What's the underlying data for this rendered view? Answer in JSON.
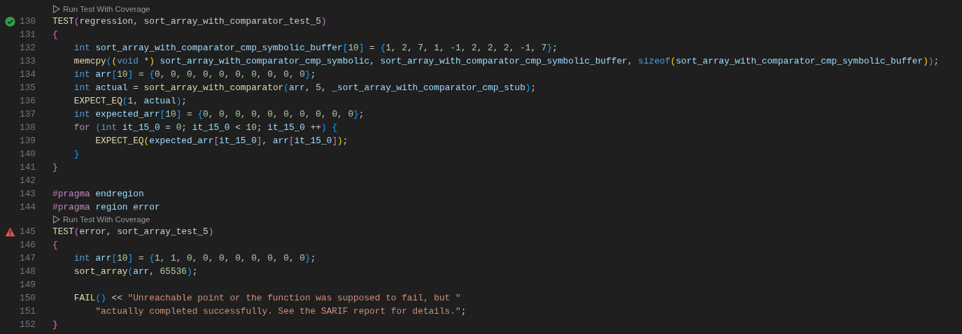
{
  "editor": {
    "lines": [
      {
        "kind": "codelens",
        "label": "Run Test With Coverage"
      },
      {
        "kind": "code",
        "number": "130",
        "passed": true,
        "tokens": [
          {
            "kind": "function",
            "text": "TEST"
          },
          {
            "kind": "bracket2",
            "text": "("
          },
          {
            "kind": "plain",
            "text": "regression, sort_array_with_comparator_test_5"
          },
          {
            "kind": "bracket2",
            "text": ")"
          }
        ]
      },
      {
        "kind": "code",
        "number": "131",
        "tokens": [
          {
            "kind": "bracket2",
            "text": "{"
          }
        ]
      },
      {
        "kind": "code",
        "number": "132",
        "tokens": [
          {
            "kind": "keyword",
            "text": "    int"
          },
          {
            "kind": "variable",
            "text": " sort_array_with_comparator_cmp_symbolic_buffer"
          },
          {
            "kind": "bracket3",
            "text": "["
          },
          {
            "kind": "number",
            "text": "10"
          },
          {
            "kind": "bracket3",
            "text": "]"
          },
          {
            "kind": "plain",
            "text": " = "
          },
          {
            "kind": "bracket3",
            "text": "{"
          },
          {
            "kind": "number",
            "text": "1, 2, 7, 1, -1, 2, 2, 2, -1, 7"
          },
          {
            "kind": "bracket3",
            "text": "}"
          },
          {
            "kind": "plain",
            "text": ";"
          }
        ]
      },
      {
        "kind": "code",
        "number": "133",
        "tokens": [
          {
            "kind": "function",
            "text": "    memcpy"
          },
          {
            "kind": "bracket3",
            "text": "("
          },
          {
            "kind": "bracket1",
            "text": "("
          },
          {
            "kind": "keyword",
            "text": "void"
          },
          {
            "kind": "plain",
            "text": " *"
          },
          {
            "kind": "bracket1",
            "text": ")"
          },
          {
            "kind": "variable",
            "text": " sort_array_with_comparator_cmp_symbolic"
          },
          {
            "kind": "plain",
            "text": ", "
          },
          {
            "kind": "variable",
            "text": "sort_array_with_comparator_cmp_symbolic_buffer"
          },
          {
            "kind": "plain",
            "text": ", "
          },
          {
            "kind": "keyword",
            "text": "sizeof"
          },
          {
            "kind": "bracket1",
            "text": "("
          },
          {
            "kind": "variable",
            "text": "sort_array_with_comparator_cmp_symbolic_buffer"
          },
          {
            "kind": "bracket1",
            "text": ")"
          },
          {
            "kind": "bracket3",
            "text": ")"
          },
          {
            "kind": "plain",
            "text": ";"
          }
        ]
      },
      {
        "kind": "code",
        "number": "134",
        "tokens": [
          {
            "kind": "keyword",
            "text": "    int"
          },
          {
            "kind": "variable",
            "text": " arr"
          },
          {
            "kind": "bracket3",
            "text": "["
          },
          {
            "kind": "number",
            "text": "10"
          },
          {
            "kind": "bracket3",
            "text": "]"
          },
          {
            "kind": "plain",
            "text": " = "
          },
          {
            "kind": "bracket3",
            "text": "{"
          },
          {
            "kind": "number",
            "text": "0, 0, 0, 0, 0, 0, 0, 0, 0, 0"
          },
          {
            "kind": "bracket3",
            "text": "}"
          },
          {
            "kind": "plain",
            "text": ";"
          }
        ]
      },
      {
        "kind": "code",
        "number": "135",
        "tokens": [
          {
            "kind": "keyword",
            "text": "    int"
          },
          {
            "kind": "variable",
            "text": " actual"
          },
          {
            "kind": "plain",
            "text": " = "
          },
          {
            "kind": "function",
            "text": "sort_array_with_comparator"
          },
          {
            "kind": "bracket3",
            "text": "("
          },
          {
            "kind": "variable",
            "text": "arr"
          },
          {
            "kind": "plain",
            "text": ", "
          },
          {
            "kind": "number",
            "text": "5"
          },
          {
            "kind": "plain",
            "text": ", "
          },
          {
            "kind": "variable",
            "text": "_sort_array_with_comparator_cmp_stub"
          },
          {
            "kind": "bracket3",
            "text": ")"
          },
          {
            "kind": "plain",
            "text": ";"
          }
        ]
      },
      {
        "kind": "code",
        "number": "136",
        "tokens": [
          {
            "kind": "function",
            "text": "    EXPECT_EQ"
          },
          {
            "kind": "bracket3",
            "text": "("
          },
          {
            "kind": "number",
            "text": "1"
          },
          {
            "kind": "plain",
            "text": ", "
          },
          {
            "kind": "variable",
            "text": "actual"
          },
          {
            "kind": "bracket3",
            "text": ")"
          },
          {
            "kind": "plain",
            "text": ";"
          }
        ]
      },
      {
        "kind": "code",
        "number": "137",
        "tokens": [
          {
            "kind": "keyword",
            "text": "    int"
          },
          {
            "kind": "variable",
            "text": " expected_arr"
          },
          {
            "kind": "bracket3",
            "text": "["
          },
          {
            "kind": "number",
            "text": "10"
          },
          {
            "kind": "bracket3",
            "text": "]"
          },
          {
            "kind": "plain",
            "text": " = "
          },
          {
            "kind": "bracket3",
            "text": "{"
          },
          {
            "kind": "number",
            "text": "0, 0, 0, 0, 0, 0, 0, 0, 0, 0"
          },
          {
            "kind": "bracket3",
            "text": "}"
          },
          {
            "kind": "plain",
            "text": ";"
          }
        ]
      },
      {
        "kind": "code",
        "number": "138",
        "tokens": [
          {
            "kind": "control",
            "text": "    for"
          },
          {
            "kind": "bracket3",
            "text": " ("
          },
          {
            "kind": "keyword",
            "text": "int"
          },
          {
            "kind": "variable",
            "text": " it_15_0"
          },
          {
            "kind": "plain",
            "text": " = "
          },
          {
            "kind": "number",
            "text": "0"
          },
          {
            "kind": "plain",
            "text": "; "
          },
          {
            "kind": "variable",
            "text": "it_15_0"
          },
          {
            "kind": "plain",
            "text": " < "
          },
          {
            "kind": "number",
            "text": "10"
          },
          {
            "kind": "plain",
            "text": "; "
          },
          {
            "kind": "variable",
            "text": "it_15_0"
          },
          {
            "kind": "plain",
            "text": " ++"
          },
          {
            "kind": "bracket3",
            "text": ")"
          },
          {
            "kind": "bracket3",
            "text": " {"
          }
        ]
      },
      {
        "kind": "code",
        "number": "139",
        "tokens": [
          {
            "kind": "function",
            "text": "        EXPECT_EQ"
          },
          {
            "kind": "bracket1",
            "text": "("
          },
          {
            "kind": "variable",
            "text": "expected_arr"
          },
          {
            "kind": "bracket2",
            "text": "["
          },
          {
            "kind": "variable",
            "text": "it_15_0"
          },
          {
            "kind": "bracket2",
            "text": "]"
          },
          {
            "kind": "plain",
            "text": ", "
          },
          {
            "kind": "variable",
            "text": "arr"
          },
          {
            "kind": "bracket2",
            "text": "["
          },
          {
            "kind": "variable",
            "text": "it_15_0"
          },
          {
            "kind": "bracket2",
            "text": "]"
          },
          {
            "kind": "bracket1",
            "text": ")"
          },
          {
            "kind": "plain",
            "text": ";"
          }
        ]
      },
      {
        "kind": "code",
        "number": "140",
        "tokens": [
          {
            "kind": "bracket3",
            "text": "    }"
          }
        ]
      },
      {
        "kind": "code",
        "number": "141",
        "tokens": [
          {
            "kind": "bracket2",
            "text": "}"
          }
        ]
      },
      {
        "kind": "code",
        "number": "142"
      },
      {
        "kind": "code",
        "number": "143",
        "tokens": [
          {
            "kind": "directive",
            "text": "#pragma"
          },
          {
            "kind": "variable",
            "text": " endregion"
          }
        ]
      },
      {
        "kind": "code",
        "number": "144",
        "tokens": [
          {
            "kind": "directive",
            "text": "#pragma"
          },
          {
            "kind": "variable",
            "text": " region error"
          }
        ]
      },
      {
        "kind": "codelens",
        "label": "Run Test With Coverage"
      },
      {
        "kind": "code",
        "number": "145",
        "passed": false,
        "tokens": [
          {
            "kind": "function",
            "text": "TEST"
          },
          {
            "kind": "bracket2",
            "text": "("
          },
          {
            "kind": "plain",
            "text": "error, sort_array_test_5"
          },
          {
            "kind": "bracket2",
            "text": ")"
          }
        ]
      },
      {
        "kind": "code",
        "number": "146",
        "tokens": [
          {
            "kind": "bracket2",
            "text": "{"
          }
        ]
      },
      {
        "kind": "code",
        "number": "147",
        "tokens": [
          {
            "kind": "keyword",
            "text": "    int"
          },
          {
            "kind": "variable",
            "text": " arr"
          },
          {
            "kind": "bracket3",
            "text": "["
          },
          {
            "kind": "number",
            "text": "10"
          },
          {
            "kind": "bracket3",
            "text": "]"
          },
          {
            "kind": "plain",
            "text": " = "
          },
          {
            "kind": "bracket3",
            "text": "{"
          },
          {
            "kind": "number",
            "text": "1, 1, 0, 0, 0, 0, 0, 0, 0, 0"
          },
          {
            "kind": "bracket3",
            "text": "}"
          },
          {
            "kind": "plain",
            "text": ";"
          }
        ]
      },
      {
        "kind": "code",
        "number": "148",
        "tokens": [
          {
            "kind": "function",
            "text": "    sort_array"
          },
          {
            "kind": "bracket3",
            "text": "("
          },
          {
            "kind": "variable",
            "text": "arr"
          },
          {
            "kind": "plain",
            "text": ", "
          },
          {
            "kind": "number",
            "text": "65536"
          },
          {
            "kind": "bracket3",
            "text": ")"
          },
          {
            "kind": "plain",
            "text": ";"
          }
        ]
      },
      {
        "kind": "code",
        "number": "149"
      },
      {
        "kind": "code",
        "number": "150",
        "tokens": [
          {
            "kind": "function",
            "text": "    FAIL"
          },
          {
            "kind": "bracket3",
            "text": "()"
          },
          {
            "kind": "plain",
            "text": " << "
          },
          {
            "kind": "string",
            "text": "\"Unreachable point or the function was supposed to fail, but \""
          }
        ]
      },
      {
        "kind": "code",
        "number": "151",
        "tokens": [
          {
            "kind": "string",
            "text": "        \"actually completed successfully. See the SARIF report for details.\""
          },
          {
            "kind": "plain",
            "text": ";"
          }
        ]
      },
      {
        "kind": "code",
        "number": "152",
        "tokens": [
          {
            "kind": "bracket2",
            "text": "}"
          }
        ]
      }
    ]
  }
}
